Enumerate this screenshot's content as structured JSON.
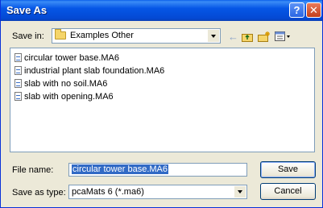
{
  "window": {
    "title": "Save As"
  },
  "titlebar": {
    "help_glyph": "?",
    "close_glyph": "✕"
  },
  "location": {
    "label": "Save in:",
    "value": "Examples Other"
  },
  "toolbar": {
    "icons": [
      "back-icon",
      "up-folder-icon",
      "new-folder-icon",
      "views-menu-icon"
    ]
  },
  "files": [
    {
      "name": "circular tower base.MA6"
    },
    {
      "name": "industrial plant slab foundation.MA6"
    },
    {
      "name": "slab with no soil.MA6"
    },
    {
      "name": "slab with opening.MA6"
    }
  ],
  "filename": {
    "label": "File name:",
    "value": "circular tower base.MA6"
  },
  "filetype": {
    "label": "Save as type:",
    "value": "pcaMats 6 (*.ma6)"
  },
  "buttons": {
    "save": "Save",
    "cancel": "Cancel"
  },
  "colors": {
    "title_bar": "#0556e6",
    "selection": "#316ac5",
    "face": "#ece9d8"
  }
}
